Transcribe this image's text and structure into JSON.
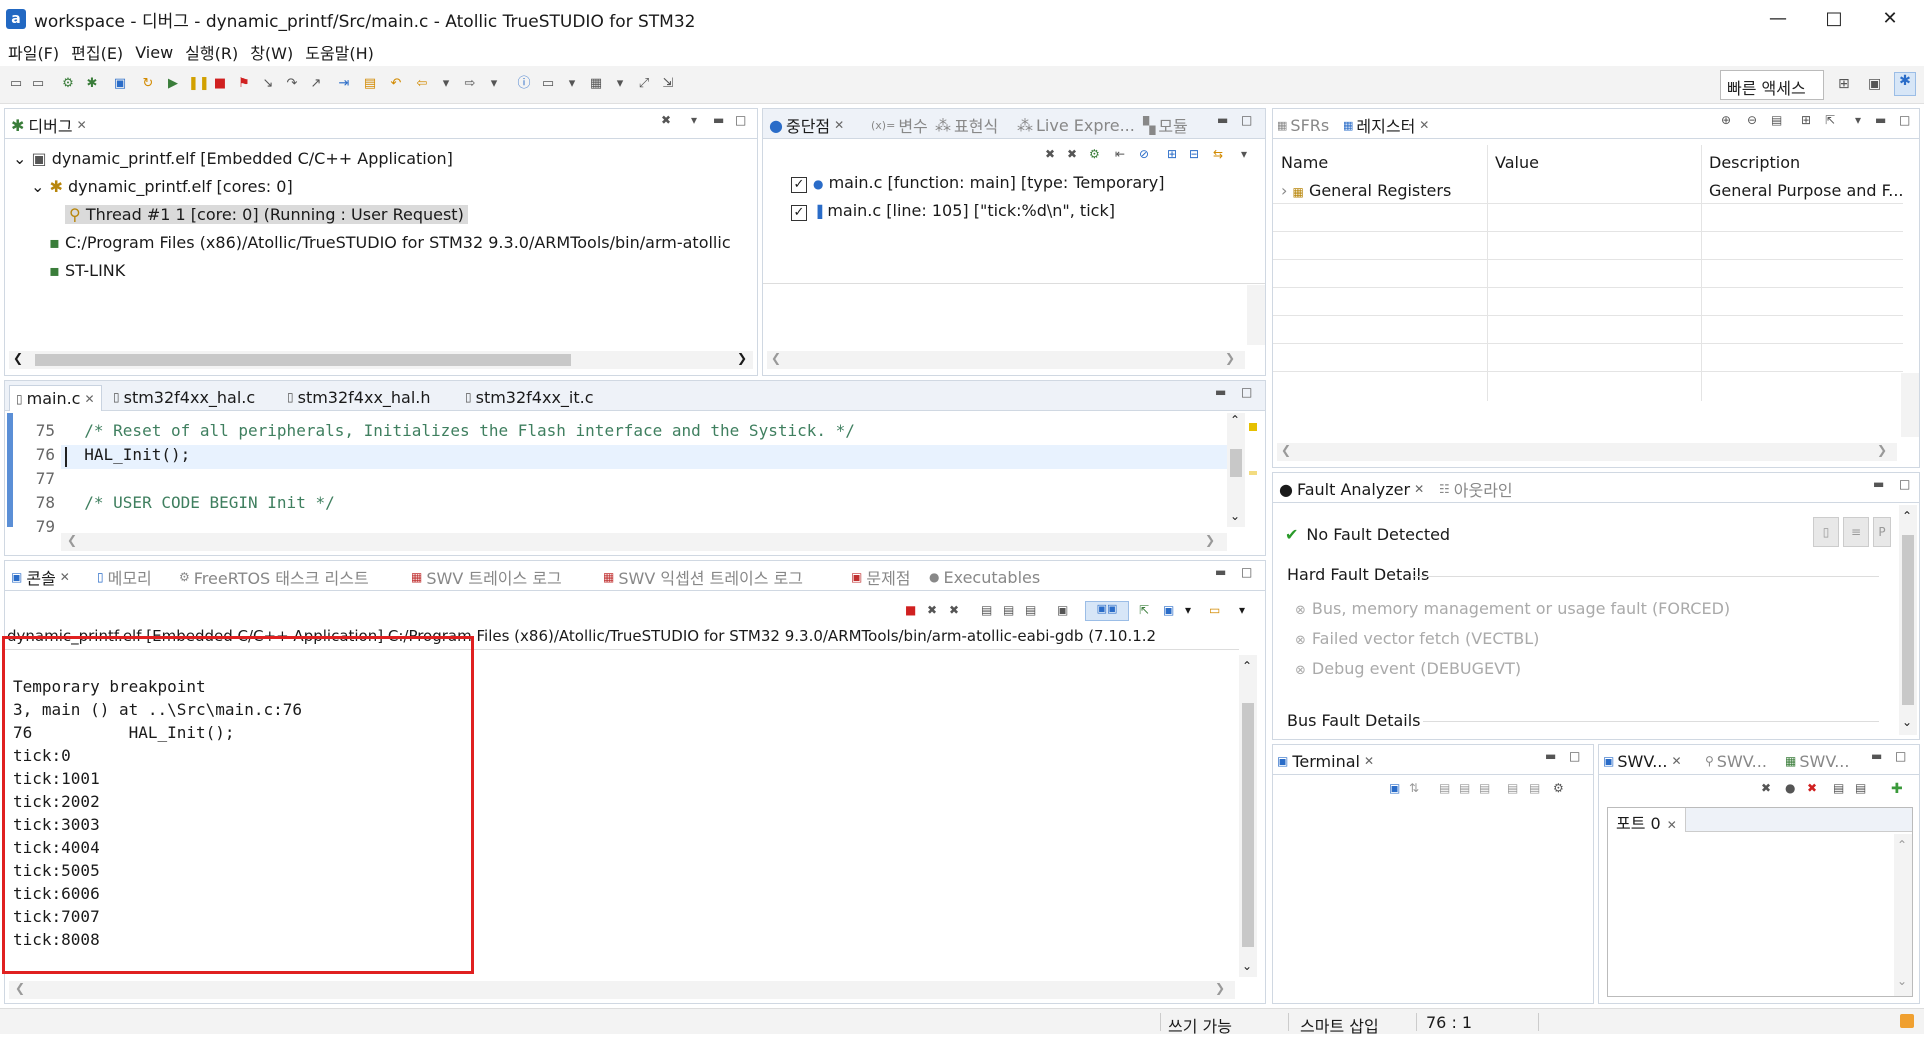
{
  "window": {
    "title": "workspace - 디버그 - dynamic_printf/Src/main.c - Atollic TrueSTUDIO for STM32",
    "app_icon": "a",
    "controls": {
      "minimize": "—",
      "maximize": "□",
      "close": "✕"
    }
  },
  "menu": [
    "파일(F)",
    "편집(E)",
    "View",
    "실행(R)",
    "창(W)",
    "도움말(H)"
  ],
  "quick_access": "빠른 액세스",
  "debug_view": {
    "tab": "디버그",
    "tree": [
      "dynamic_printf.elf [Embedded C/C++ Application]",
      "dynamic_printf.elf [cores: 0]",
      "Thread #1 1 [core: 0] (Running : User Request)",
      "C:/Program Files (x86)/Atollic/TrueSTUDIO for STM32 9.3.0/ARMTools/bin/arm-atollic",
      "ST-LINK"
    ]
  },
  "breakpoints_view": {
    "tabs": [
      "중단점",
      "변수",
      "표현식",
      "Live Expre...",
      "모듈"
    ],
    "items": [
      "main.c [function: main] [type: Temporary]",
      "main.c [line: 105] [\"tick:%d\\n\", tick]"
    ]
  },
  "registers_view": {
    "tabs": [
      "SFRs",
      "레지스터"
    ],
    "columns": [
      "Name",
      "Value",
      "Description"
    ],
    "rows": [
      {
        "name": "General Registers",
        "value": "",
        "description": "General Purpose and F..."
      }
    ]
  },
  "editor": {
    "tabs": [
      "main.c",
      "stm32f4xx_hal.c",
      "stm32f4xx_hal.h",
      "stm32f4xx_it.c"
    ],
    "lines": [
      {
        "num": "75",
        "text": "  /* Reset of all peripherals, Initializes the Flash interface and the Systick. */"
      },
      {
        "num": "76",
        "text": "  HAL_Init();"
      },
      {
        "num": "77",
        "text": ""
      },
      {
        "num": "78",
        "text": "  /* USER CODE BEGIN Init */"
      },
      {
        "num": "79",
        "text": ""
      }
    ]
  },
  "fault_analyzer": {
    "tabs": [
      "Fault Analyzer",
      "아웃라인"
    ],
    "status": "No Fault Detected",
    "hard_fault_title": "Hard Fault Details",
    "hard_fault_items": [
      "Bus, memory management or usage fault (FORCED)",
      "Failed vector fetch (VECTBL)",
      "Debug event (DEBUGEVT)"
    ],
    "bus_fault_title": "Bus Fault Details"
  },
  "console": {
    "tabs": [
      "콘솔",
      "메모리",
      "FreeRTOS 태스크 리스트",
      "SWV 트레이스 로그",
      "SWV 익셉션 트레이스 로그",
      "문제점",
      "Executables"
    ],
    "header": "dynamic_printf.elf [Embedded C/C++ Application] C:/Program Files (x86)/Atollic/TrueSTUDIO for STM32 9.3.0/ARMTools/bin/arm-atollic-eabi-gdb (7.10.1.2",
    "lines": [
      "",
      "Temporary breakpoint",
      "3, main () at ..\\Src\\main.c:76",
      "76\t    HAL_Init();",
      "tick:0",
      "tick:1001",
      "tick:2002",
      "tick:3003",
      "tick:4004",
      "tick:5005",
      "tick:6006",
      "tick:7007",
      "tick:8008"
    ]
  },
  "terminal": {
    "tab": "Terminal"
  },
  "swv": {
    "tabs": [
      "SWV...",
      "SWV...",
      "SWV..."
    ],
    "port_tab": "포트 0"
  },
  "status": {
    "writable": "쓰기 가능",
    "insert": "스마트 삽입",
    "position": "76 : 1"
  }
}
